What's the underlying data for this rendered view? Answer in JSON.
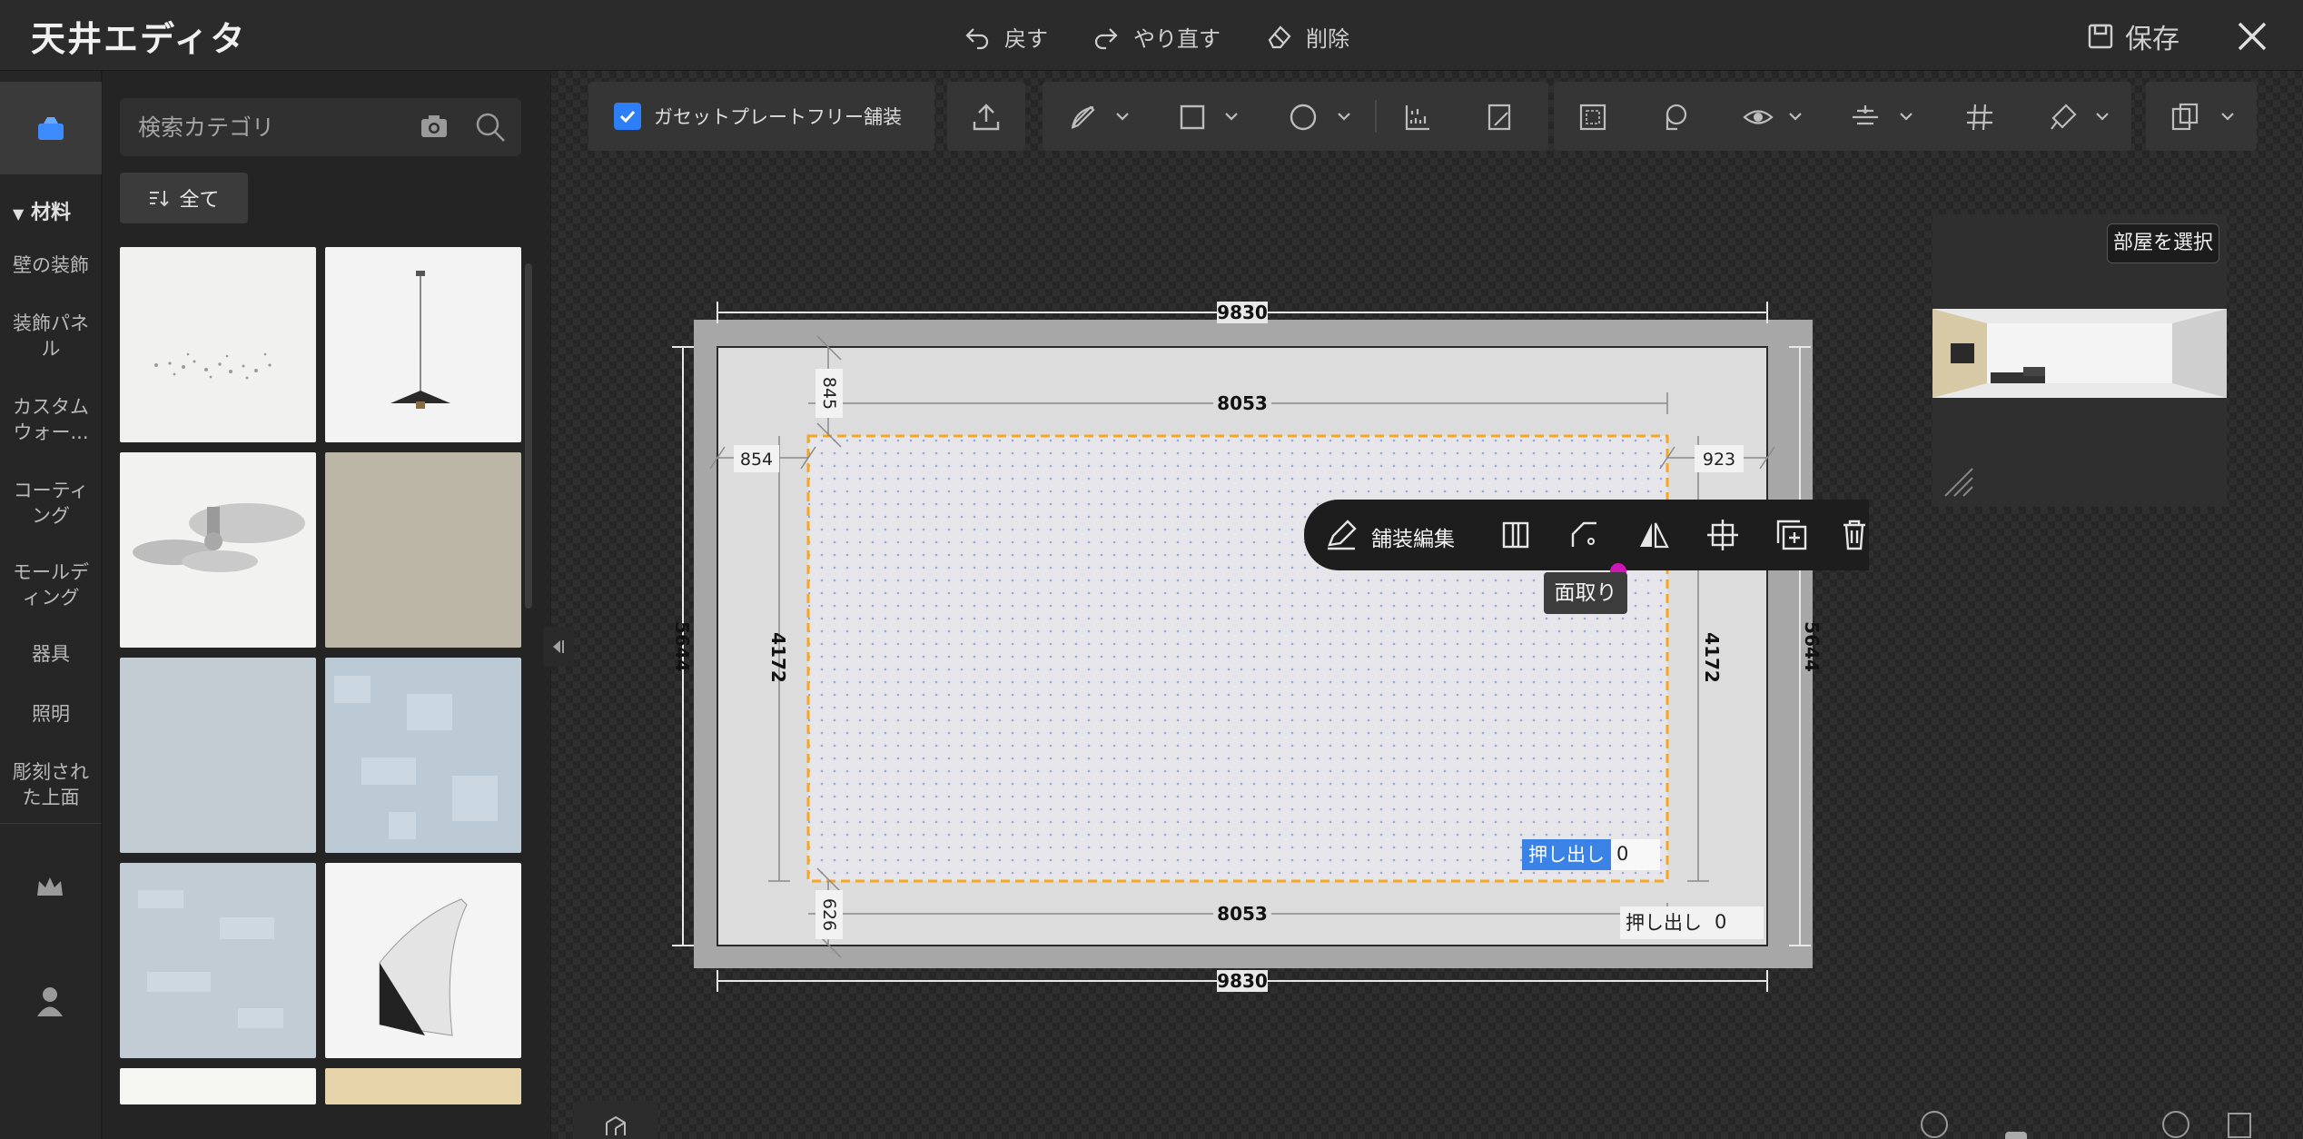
{
  "app": {
    "title": "天井エディタ"
  },
  "topbar": {
    "undo_label": "戻す",
    "redo_label": "やり直す",
    "delete_label": "削除",
    "save_label": "保存"
  },
  "rail": {
    "section_label": "材料",
    "items": [
      {
        "label": "壁の装飾"
      },
      {
        "label": "装飾パネル"
      },
      {
        "label": "カスタムウォー..."
      },
      {
        "label": "コーティング"
      },
      {
        "label": "モールディング"
      },
      {
        "label": "器具"
      },
      {
        "label": "照明"
      },
      {
        "label": "彫刻された上面"
      }
    ]
  },
  "catalog": {
    "search_placeholder": "検索カテゴリ",
    "filter_label": "全て",
    "items": [
      {
        "name": "ceiling-particles",
        "color": "#f1f1ef"
      },
      {
        "name": "pendant-lamp",
        "color": "#f3f3f3"
      },
      {
        "name": "ceiling-fan",
        "color": "#f2f2f0"
      },
      {
        "name": "taupe-panel",
        "color": "#bbb6a5"
      },
      {
        "name": "light-blue-panel",
        "color": "#c3ccd3"
      },
      {
        "name": "blue-pattern-panel",
        "color": "#bdcbd6"
      },
      {
        "name": "frosted-blue-panel",
        "color": "#c1ccd5"
      },
      {
        "name": "cove-molding",
        "color": "#f4f4f4"
      },
      {
        "name": "white-panel",
        "color": "#f5f5f2"
      },
      {
        "name": "sand-panel",
        "color": "#e7d4aa"
      }
    ]
  },
  "toolbar": {
    "gasket_label": "ガセットプレートフリー舗装",
    "gasket_checked": true
  },
  "drawing": {
    "outer_width": "9830",
    "outer_width_bottom": "9830",
    "outer_height_left": "5644",
    "outer_height_right": "5644",
    "inner_width_top": "8053",
    "inner_width_bottom": "8053",
    "inner_height_left": "4172",
    "inner_height_right": "4172",
    "offset_top": "845",
    "offset_bottom": "626",
    "offset_left": "854",
    "offset_right": "923",
    "extrude_label_inner": "押し出し",
    "extrude_value_inner": "0",
    "extrude_label_outer": "押し出し",
    "extrude_value_outer": "0"
  },
  "floating_toolbar": {
    "label": "舗装編集",
    "tooltip": "面取り"
  },
  "preview": {
    "room_select_label": "部屋を選択"
  },
  "colors": {
    "accent": "#2d7ff9",
    "selection": "#f5a623",
    "highlight": "#3b82e6"
  }
}
